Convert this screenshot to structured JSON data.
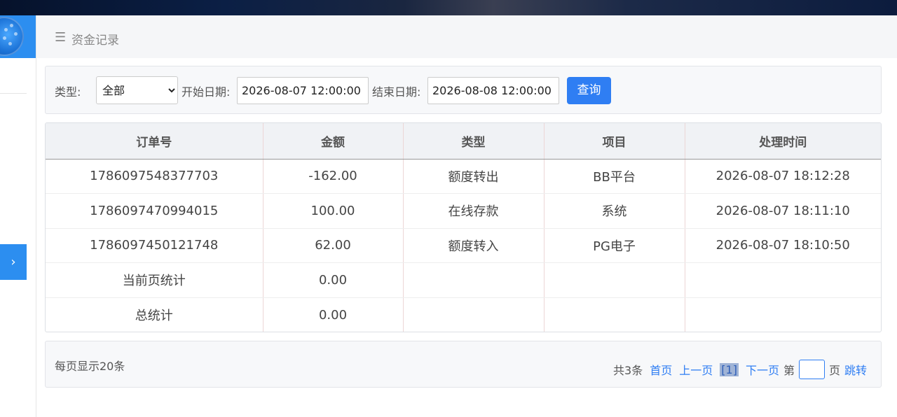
{
  "header": {
    "menu_icon": "menu-icon",
    "title": "资金记录"
  },
  "filter": {
    "type_label": "类型:",
    "type_selected": "全部",
    "start_label": "开始日期:",
    "start_value": "2026-08-07 12:00:00",
    "end_label": "结束日期:",
    "end_value": "2026-08-08 12:00:00",
    "query_label": "查询"
  },
  "table": {
    "headers": [
      "订单号",
      "金额",
      "类型",
      "项目",
      "处理时间"
    ],
    "rows": [
      [
        "1786097548377703",
        "-162.00",
        "额度转出",
        "BB平台",
        "2026-08-07 18:12:28"
      ],
      [
        "1786097470994015",
        "100.00",
        "在线存款",
        "系统",
        "2026-08-07 18:11:10"
      ],
      [
        "1786097450121748",
        "62.00",
        "额度转入",
        "PG电子",
        "2026-08-07 18:10:50"
      ]
    ],
    "page_total": {
      "label": "当前页统计",
      "amount": "0.00"
    },
    "grand_total": {
      "label": "总统计",
      "amount": "0.00"
    }
  },
  "pager": {
    "per_page": "每页显示20条",
    "total": "共3条",
    "first": "首页",
    "prev": "上一页",
    "current": "[1]",
    "next": "下一页",
    "page_prefix": "第",
    "page_suffix": "页",
    "jump": "跳转"
  },
  "sidebar": {
    "toggle_icon": "chevron-right-icon"
  },
  "colors": {
    "accent": "#2f7ef3",
    "sidebar_blue": "#2c8ef0"
  }
}
